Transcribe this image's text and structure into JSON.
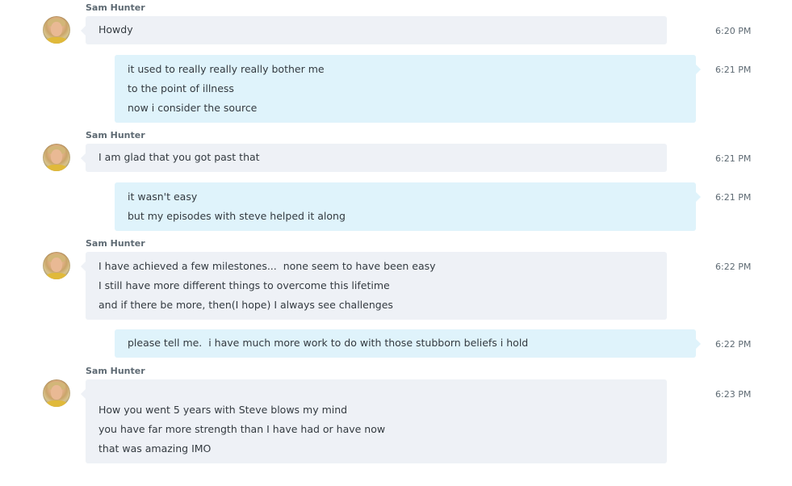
{
  "messages": [
    {
      "sender": "Sam Hunter",
      "direction": "in",
      "time": "6:20 PM",
      "lines": [
        "Howdy"
      ]
    },
    {
      "sender": "",
      "direction": "out",
      "time": "6:21 PM",
      "lines": [
        "it used to really really really bother me",
        "to the point of illness",
        "now i consider the source"
      ]
    },
    {
      "sender": "Sam Hunter",
      "direction": "in",
      "time": "6:21 PM",
      "lines": [
        "I am glad that you got past that"
      ]
    },
    {
      "sender": "",
      "direction": "out",
      "time": "6:21 PM",
      "lines": [
        "it wasn't easy",
        "but my episodes with steve helped it along"
      ]
    },
    {
      "sender": "Sam Hunter",
      "direction": "in",
      "time": "6:22 PM",
      "lines": [
        "I have achieved a few milestones...  none seem to have been easy",
        "I still have more different things to overcome this lifetime",
        "and if there be more, then(I hope) I always see challenges"
      ]
    },
    {
      "sender": "",
      "direction": "out",
      "time": "6:22 PM",
      "lines": [
        "please tell me.  i have much more work to do with those stubborn beliefs i hold"
      ]
    },
    {
      "sender": "Sam Hunter",
      "direction": "in",
      "time": "6:23 PM",
      "lines": [
        "",
        "How you went 5 years with Steve blows my mind",
        "you have far more strength than I have had or have now",
        "that was amazing IMO"
      ]
    }
  ],
  "colors": {
    "incoming_bubble": "#eef1f6",
    "outgoing_bubble": "#dff3fb",
    "text": "#333a40",
    "meta_text": "#5e6a73"
  },
  "icons": {
    "avatar": "avatar"
  }
}
